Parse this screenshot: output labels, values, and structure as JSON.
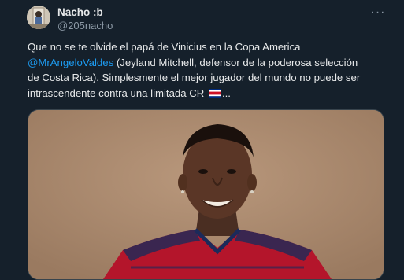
{
  "author": {
    "display_name": "Nacho :b",
    "handle": "@205nacho",
    "avatar_icon": "avatar-photo"
  },
  "more_icon": "more-horizontal-icon",
  "tweet": {
    "line1": "Que no se te olvide el papá de Vinicius en la Copa America",
    "mention": "@MrAngeloValdes",
    "line2_rest": " (Jeyland Mitchell, defensor de la poderosa selección",
    "line3": "de Costa Rica). Simplesmente el mejor jugador del mundo no puede ser",
    "line4_start": "intrascendente contra una limitada CR ",
    "flag_icon": "costa-rica-flag-icon",
    "line4_end": "..."
  },
  "colors": {
    "background": "#15202b",
    "text": "#e7e9ea",
    "secondary": "#8b98a5",
    "link": "#1d9bf0"
  }
}
